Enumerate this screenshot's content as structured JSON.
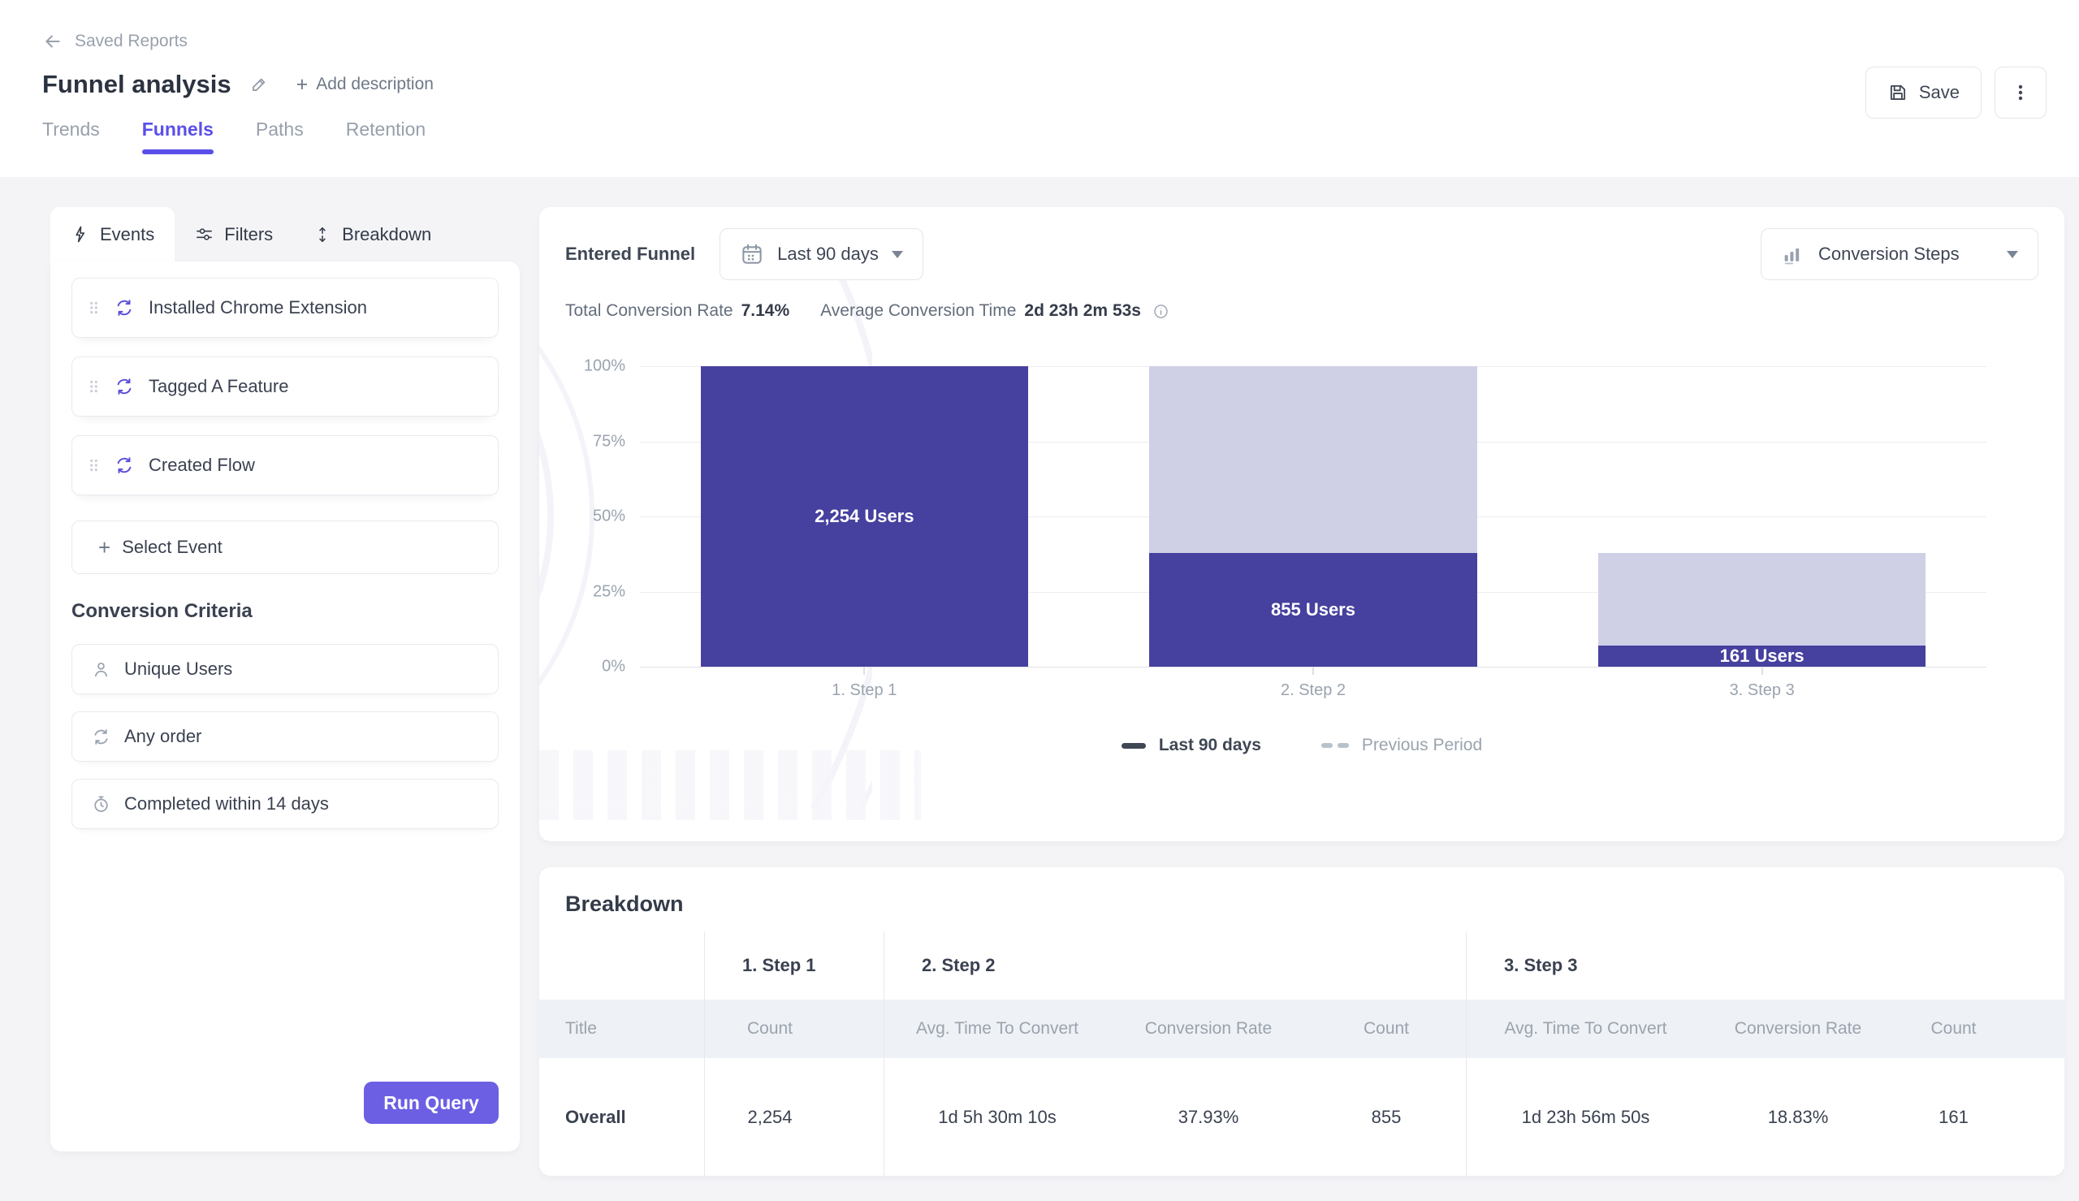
{
  "header": {
    "back_label": "Saved Reports",
    "title": "Funnel analysis",
    "add_description": {
      "plus": "+",
      "label": "Add description"
    },
    "save_label": "Save",
    "tabs": [
      {
        "label": "Trends",
        "active": false
      },
      {
        "label": "Funnels",
        "active": true
      },
      {
        "label": "Paths",
        "active": false
      },
      {
        "label": "Retention",
        "active": false
      }
    ]
  },
  "left_panel": {
    "tabs": [
      {
        "label": "Events",
        "icon": "lightning-icon",
        "active": true
      },
      {
        "label": "Filters",
        "icon": "sliders-icon",
        "active": false
      },
      {
        "label": "Breakdown",
        "icon": "arrows-vertical-icon",
        "active": false
      }
    ],
    "events": [
      {
        "label": "Installed Chrome Extension",
        "icon": "cycle-icon"
      },
      {
        "label": "Tagged A Feature",
        "icon": "cycle-icon"
      },
      {
        "label": "Created Flow",
        "icon": "cycle-icon"
      }
    ],
    "select_event": {
      "plus": "+",
      "label": "Select Event"
    },
    "conversion_criteria": {
      "heading": "Conversion Criteria",
      "items": [
        {
          "label": "Unique Users",
          "icon": "person-icon"
        },
        {
          "label": "Any order",
          "icon": "cycle-icon"
        },
        {
          "label": "Completed within 14 days",
          "icon": "stopwatch-icon"
        }
      ]
    },
    "run_query_label": "Run Query"
  },
  "funnel_panel": {
    "title": "Entered Funnel",
    "date_button": {
      "label": "Last 90 days",
      "icon": "calendar-icon"
    },
    "view_button": {
      "label": "Conversion Steps",
      "icon": "bar-chart-icon"
    },
    "stats": [
      {
        "label": "Total Conversion Rate",
        "value": "7.14%"
      },
      {
        "label": "Average Conversion Time",
        "value": "2d 23h 2m 53s"
      }
    ],
    "legend": [
      {
        "label": "Last 90 days",
        "swatch": "solid-dark"
      },
      {
        "label": "Previous Period",
        "swatch": "dashed-gray"
      }
    ]
  },
  "chart_data": {
    "type": "bar",
    "categories": [
      "1. Step 1",
      "2. Step 2",
      "3. Step 3"
    ],
    "series": [
      {
        "name": "Entered from previous step (light)",
        "values_pct": [
          100,
          100,
          37.93
        ],
        "color": "#cfcfe6"
      },
      {
        "name": "Converted (dark)",
        "values_pct": [
          100,
          37.93,
          7.14
        ],
        "color": "#46409f"
      }
    ],
    "counts": [
      2254,
      855,
      161
    ],
    "bar_labels": [
      "2,254 Users",
      "855 Users",
      "161 Users"
    ],
    "y_ticks": [
      "100%",
      "75%",
      "50%",
      "25%",
      "0%"
    ],
    "ylim": [
      0,
      100
    ],
    "grid": true,
    "legend_position": "bottom",
    "total_conversion_rate": "7.14%",
    "average_conversion_time": "2d 23h 2m 53s"
  },
  "breakdown": {
    "title": "Breakdown",
    "groups": [
      "1. Step 1",
      "2. Step 2",
      "3. Step 3"
    ],
    "columns": [
      "Title",
      "Count",
      "Avg. Time To Convert",
      "Conversion Rate",
      "Count",
      "Avg. Time To Convert",
      "Conversion Rate",
      "Count"
    ],
    "rows": [
      {
        "cells": [
          "Overall",
          "2,254",
          "1d 5h 30m 10s",
          "37.93%",
          "855",
          "1d 23h 56m 50s",
          "18.83%",
          "161"
        ]
      }
    ]
  },
  "colors": {
    "accent": "#5a4fe8",
    "run_button": "#6c5fe4",
    "bar_dark": "#46409f",
    "bar_light": "#cfcfe6",
    "page_bg": "#f4f4f7",
    "subheader_bg": "#eef1f5"
  }
}
